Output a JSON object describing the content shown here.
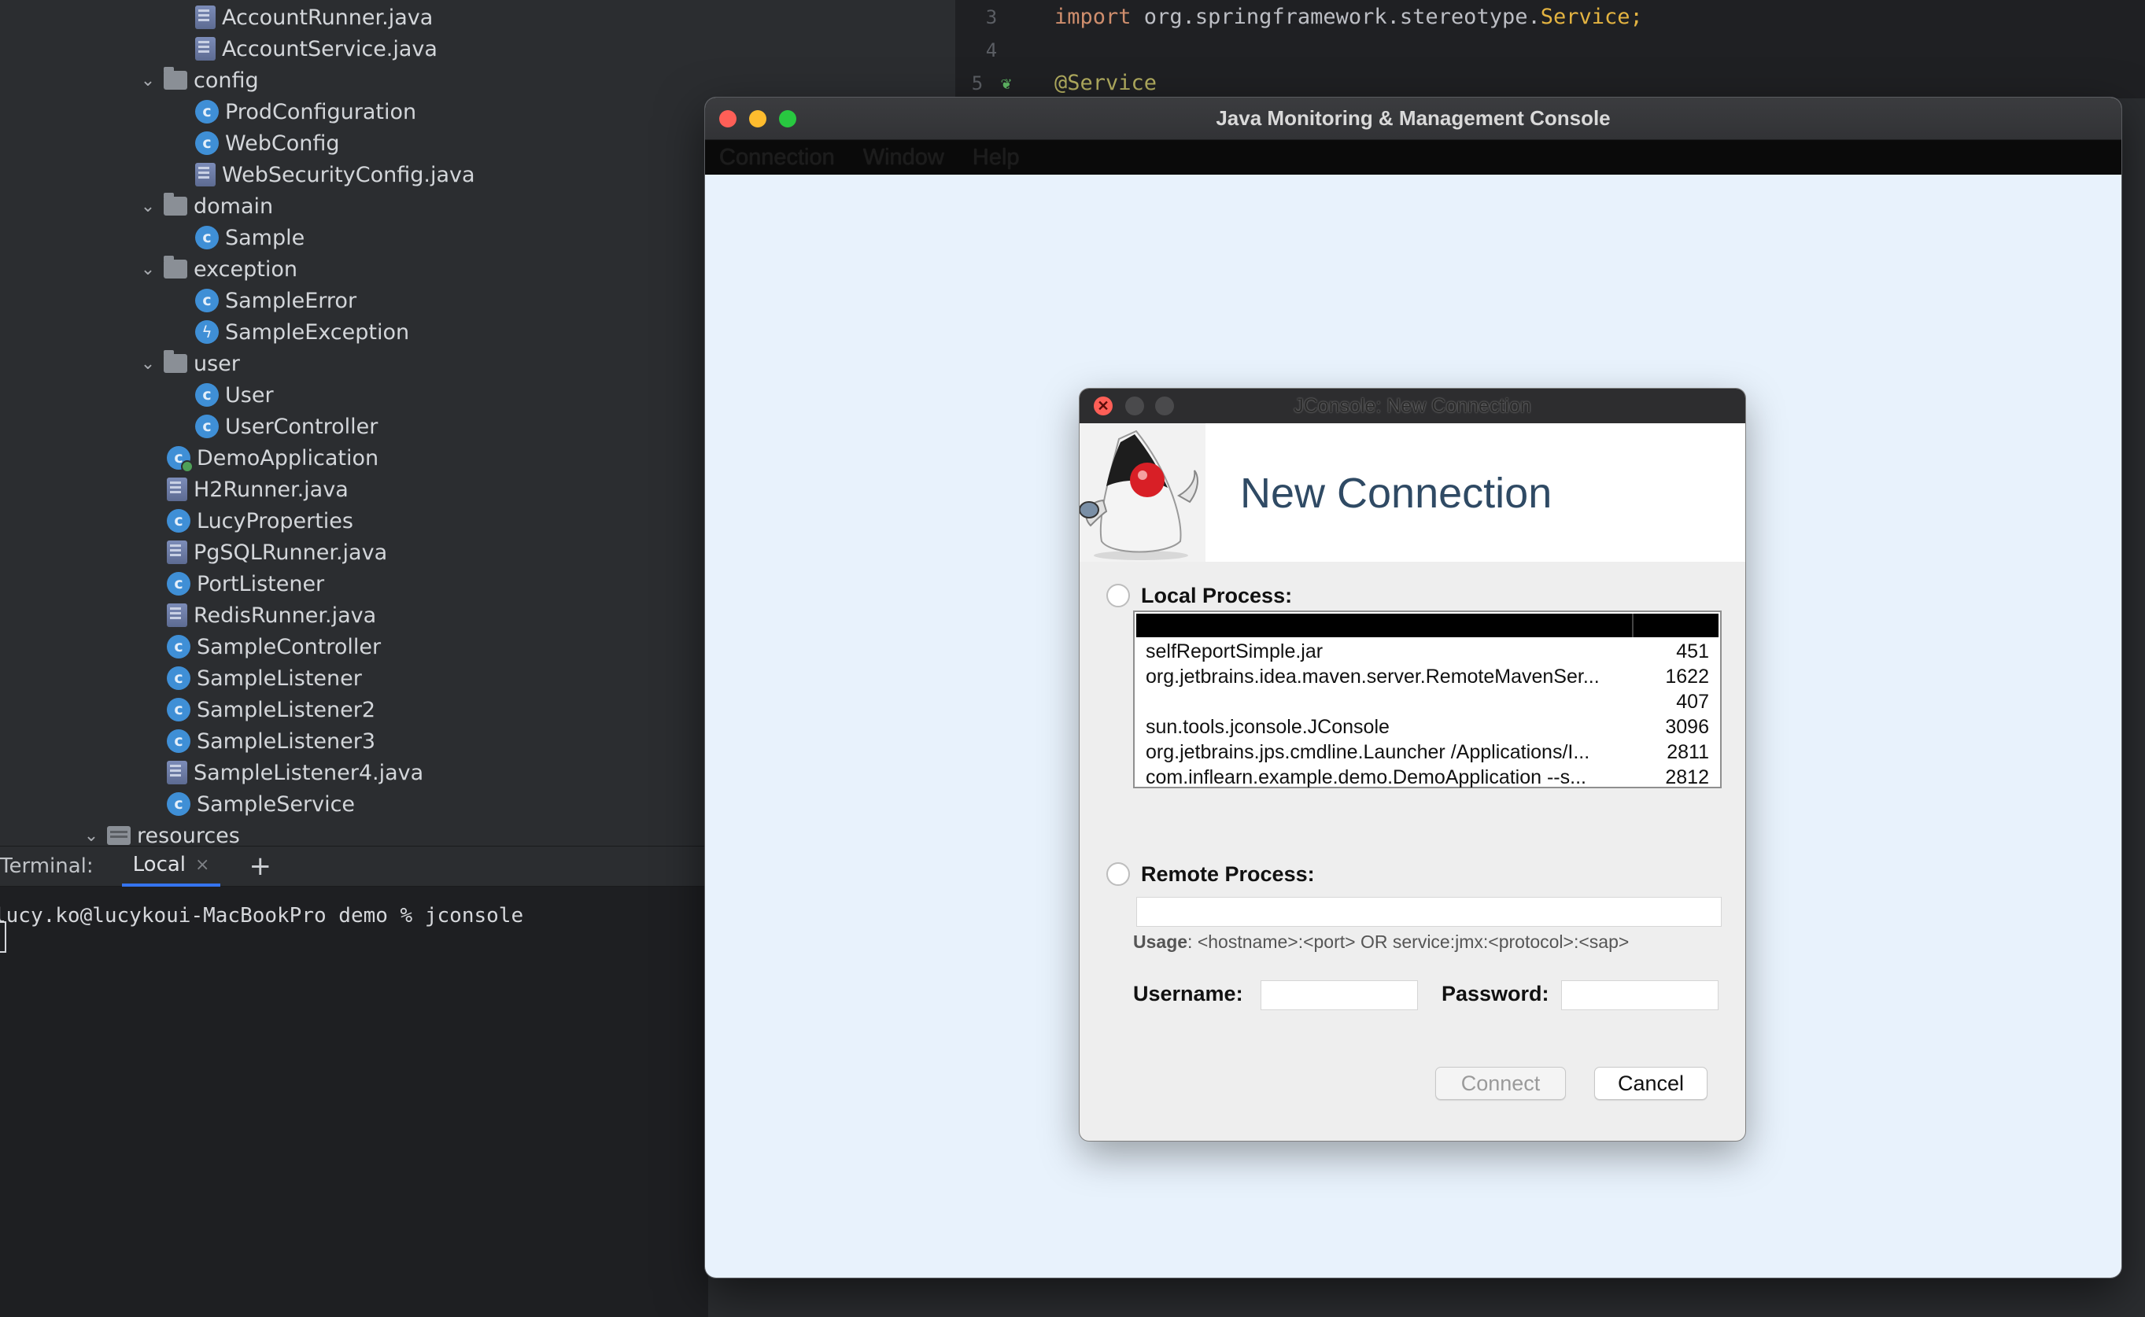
{
  "project_tree": {
    "items": [
      {
        "label": "AccountRunner.java",
        "icon": "java-file-icon",
        "level": 2
      },
      {
        "label": "AccountService.java",
        "icon": "java-file-icon",
        "level": 2
      },
      {
        "label": "config",
        "icon": "folder-icon",
        "level": 1,
        "expanded": true
      },
      {
        "label": "ProdConfiguration",
        "icon": "class-icon",
        "level": 2
      },
      {
        "label": "WebConfig",
        "icon": "class-icon",
        "level": 2
      },
      {
        "label": "WebSecurityConfig.java",
        "icon": "java-file-icon",
        "level": 2
      },
      {
        "label": "domain",
        "icon": "folder-icon",
        "level": 1,
        "expanded": true
      },
      {
        "label": "Sample",
        "icon": "class-icon",
        "level": 2
      },
      {
        "label": "exception",
        "icon": "folder-icon",
        "level": 1,
        "expanded": true
      },
      {
        "label": "SampleError",
        "icon": "class-icon",
        "level": 2
      },
      {
        "label": "SampleException",
        "icon": "exception-class-icon",
        "level": 2
      },
      {
        "label": "user",
        "icon": "folder-icon",
        "level": 1,
        "expanded": true
      },
      {
        "label": "User",
        "icon": "class-icon",
        "level": 2
      },
      {
        "label": "UserController",
        "icon": "class-icon",
        "level": 2
      },
      {
        "label": "DemoApplication",
        "icon": "spring-app-icon",
        "level": 1
      },
      {
        "label": "H2Runner.java",
        "icon": "java-file-icon",
        "level": 1
      },
      {
        "label": "LucyProperties",
        "icon": "class-icon",
        "level": 1
      },
      {
        "label": "PgSQLRunner.java",
        "icon": "java-file-icon",
        "level": 1
      },
      {
        "label": "PortListener",
        "icon": "class-icon",
        "level": 1
      },
      {
        "label": "RedisRunner.java",
        "icon": "java-file-icon",
        "level": 1
      },
      {
        "label": "SampleController",
        "icon": "class-icon",
        "level": 1
      },
      {
        "label": "SampleListener",
        "icon": "class-icon",
        "level": 1
      },
      {
        "label": "SampleListener2",
        "icon": "class-icon",
        "level": 1
      },
      {
        "label": "SampleListener3",
        "icon": "class-icon",
        "level": 1
      },
      {
        "label": "SampleListener4.java",
        "icon": "java-file-icon",
        "level": 1
      },
      {
        "label": "SampleService",
        "icon": "class-icon",
        "level": 1
      },
      {
        "label": "resources",
        "icon": "resources-folder-icon",
        "level": 0,
        "expanded": true
      }
    ]
  },
  "editor": {
    "lines": [
      {
        "number": "3",
        "keyword": "import",
        "package": " org.springframework.stereotype.",
        "class": "Service",
        "end": ";"
      },
      {
        "number": "4"
      },
      {
        "number": "5",
        "annotation": "@Service"
      }
    ]
  },
  "terminal": {
    "label": "Terminal:",
    "tab_label": "Local",
    "close_glyph": "×",
    "add_glyph": "+",
    "prompt_line": "lucy.ko@lucykoui-MacBookPro demo % jconsole"
  },
  "jconsole": {
    "window_title": "Java Monitoring & Management Console",
    "menu": [
      "Connection",
      "Window",
      "Help"
    ],
    "dialog": {
      "title": "JConsole: New Connection",
      "heading": "New Connection",
      "local_process_label": "Local Process:",
      "processes": [
        {
          "name": "selfReportSimple.jar",
          "pid": "451"
        },
        {
          "name": "org.jetbrains.idea.maven.server.RemoteMavenSer...",
          "pid": "1622"
        },
        {
          "name": "",
          "pid": "407"
        },
        {
          "name": "sun.tools.jconsole.JConsole",
          "pid": "3096"
        },
        {
          "name": "org.jetbrains.jps.cmdline.Launcher /Applications/I...",
          "pid": "2811"
        },
        {
          "name": "com.inflearn.example.demo.DemoApplication --s...",
          "pid": "2812"
        }
      ],
      "remote_process_label": "Remote Process:",
      "remote_value": "",
      "usage_label": "Usage",
      "usage_text": ": <hostname>:<port> OR service:jmx:<protocol>:<sap>",
      "username_label": "Username:",
      "password_label": "Password:",
      "username_value": "",
      "password_value": "",
      "connect_label": "Connect",
      "cancel_label": "Cancel",
      "close_glyph": "✕"
    }
  },
  "colors": {
    "ide_background": "#2b2d30",
    "terminal_background": "#1e1f22",
    "jconsole_background": "#e8f2fc",
    "heading_blue": "#2f4a64",
    "class_icon_blue": "#3f8fd6"
  }
}
